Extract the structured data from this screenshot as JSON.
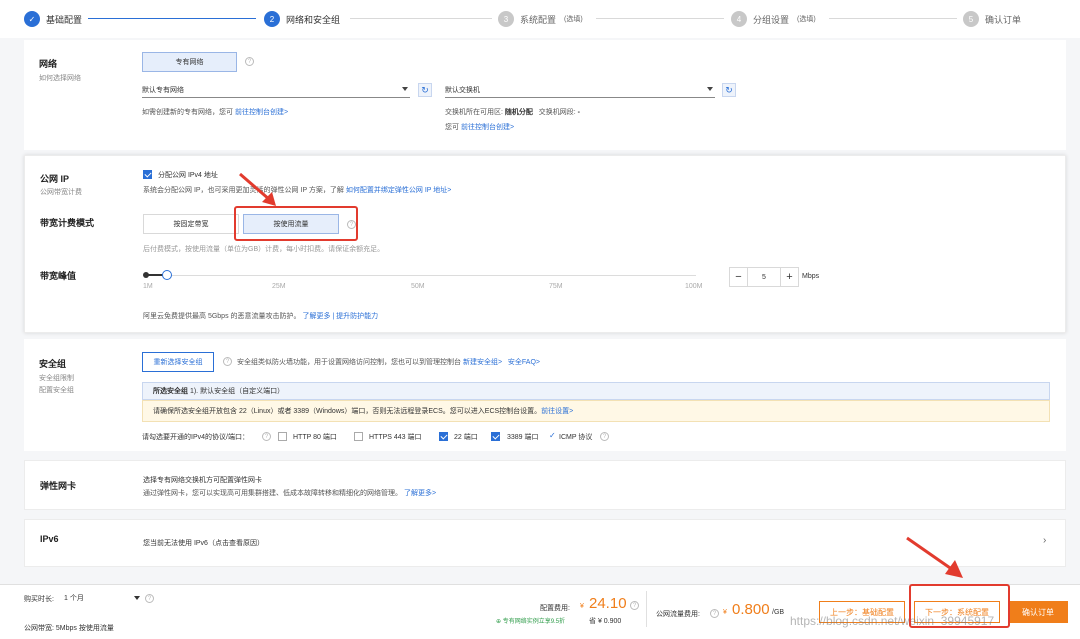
{
  "steps": [
    {
      "num": "✓",
      "label": "基础配置",
      "optional": ""
    },
    {
      "num": "2",
      "label": "网络和安全组",
      "optional": ""
    },
    {
      "num": "3",
      "label": "系统配置",
      "optional": "(选填)"
    },
    {
      "num": "4",
      "label": "分组设置",
      "optional": "(选填)"
    },
    {
      "num": "5",
      "label": "确认订单",
      "optional": ""
    }
  ],
  "network": {
    "title": "网络",
    "subtitle": "如何选择网络",
    "tab": "专有网络",
    "vpc_select": "默认专有网络",
    "vswitch_select": "默认交换机",
    "vpc_hint": "如需创建新的专有网络，您可",
    "vpc_hint_link": "前往控制台创建>",
    "zone_label": "交换机所在可用区:",
    "zone_value": "随机分配",
    "cidr_label": "交换机网段:",
    "cidr_value": "-",
    "vswitch_hint": "您可",
    "vswitch_hint_link": "前往控制台创建>"
  },
  "public_ip": {
    "title": "公网 IP",
    "subtitle": "公网带宽计费",
    "checkbox_label": "分配公网 IPv4 地址",
    "desc": "系统会分配公网 IP，也可采用更加灵活的弹性公网 IP 方案，了解",
    "desc_link": "如何配置并绑定弹性公网 IP 地址>",
    "billing_title": "带宽计费模式",
    "billing_fixed": "按固定带宽",
    "billing_traffic": "按使用流量",
    "billing_desc": "后付费模式，按使用流量（单位为GB）计费，每小时扣费。请保证余额充足。",
    "peak_title": "带宽峰值",
    "ticks": [
      "1M",
      "25M",
      "50M",
      "75M",
      "100M"
    ],
    "value": "5",
    "unit": "Mbps",
    "slider_fraction": 0.04,
    "protect_text": "阿里云免费提供最高 5Gbps 的恶意流量攻击防护。",
    "protect_link": "了解更多 | 提升防护能力"
  },
  "security": {
    "title": "安全组",
    "subtitle1": "安全组限制",
    "subtitle2": "配置安全组",
    "reselect_btn": "重新选择安全组",
    "desc": "安全组类似防火墙功能，用于设置网络访问控制，您也可以到管理控制台",
    "desc_link1": "新建安全组>",
    "desc_link2": "安全FAQ>",
    "selected_label": "所选安全组",
    "selected_value": "1). 默认安全组（自定义端口）",
    "warning": "请确保所选安全组开放包含 22（Linux）或者 3389（Windows）端口，否则无法远程登录ECS。您可以进入ECS控制台设置。",
    "warning_link": "前往设置>",
    "ports_label": "请勾选要开通的IPv4的协议/端口：",
    "ports": [
      {
        "label": "HTTP 80 端口",
        "checked": false
      },
      {
        "label": "HTTPS 443 端口",
        "checked": false
      },
      {
        "label": "22 端口",
        "checked": true
      },
      {
        "label": "3389 端口",
        "checked": true
      }
    ],
    "icmp": "ICMP 协议"
  },
  "eni": {
    "title": "弹性网卡",
    "line1": "选择专有网络交换机方可配置弹性网卡",
    "line2": "通过弹性网卡，您可以实现高可用集群搭建、低成本故障转移和精细化的网络管理。",
    "link": "了解更多>"
  },
  "ipv6": {
    "title": "IPv6",
    "text": "您当前无法使用 IPv6（点击查看原因）"
  },
  "bottom": {
    "duration_label": "购买时长:",
    "duration_value": "1 个月",
    "bandwidth_label": "公网带宽:",
    "bandwidth_value": "5Mbps 按使用流量",
    "config_fee_label": "配置费用:",
    "config_fee_currency": "¥",
    "config_fee_value": "24.10",
    "promo": "专有网络实例立享9.5折",
    "save_label": "省 ¥ 0.900",
    "traffic_fee_label": "公网流量费用:",
    "traffic_fee_currency": "¥",
    "traffic_fee_value": "0.800",
    "traffic_fee_unit": "/GB",
    "prev_btn": "上一步：基础配置",
    "next_btn": "下一步：系统配置",
    "confirm_btn": "确认订单",
    "watermark": "https://blog.csdn.net/weixin_39945917"
  },
  "colors": {
    "accent": "#2a6fd6",
    "price": "#f07e1a",
    "annotation": "#e23b2e"
  }
}
